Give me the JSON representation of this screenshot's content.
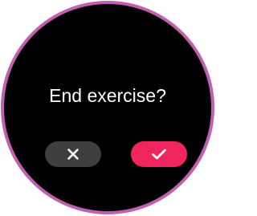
{
  "dialog": {
    "prompt": "End exercise?",
    "cancel": {
      "icon": "close-icon",
      "color": "#3f3f3f"
    },
    "confirm": {
      "icon": "check-icon",
      "color": "#f0255e"
    }
  },
  "theme": {
    "ring": "#c060b0",
    "background": "#000000",
    "text": "#ffffff"
  }
}
